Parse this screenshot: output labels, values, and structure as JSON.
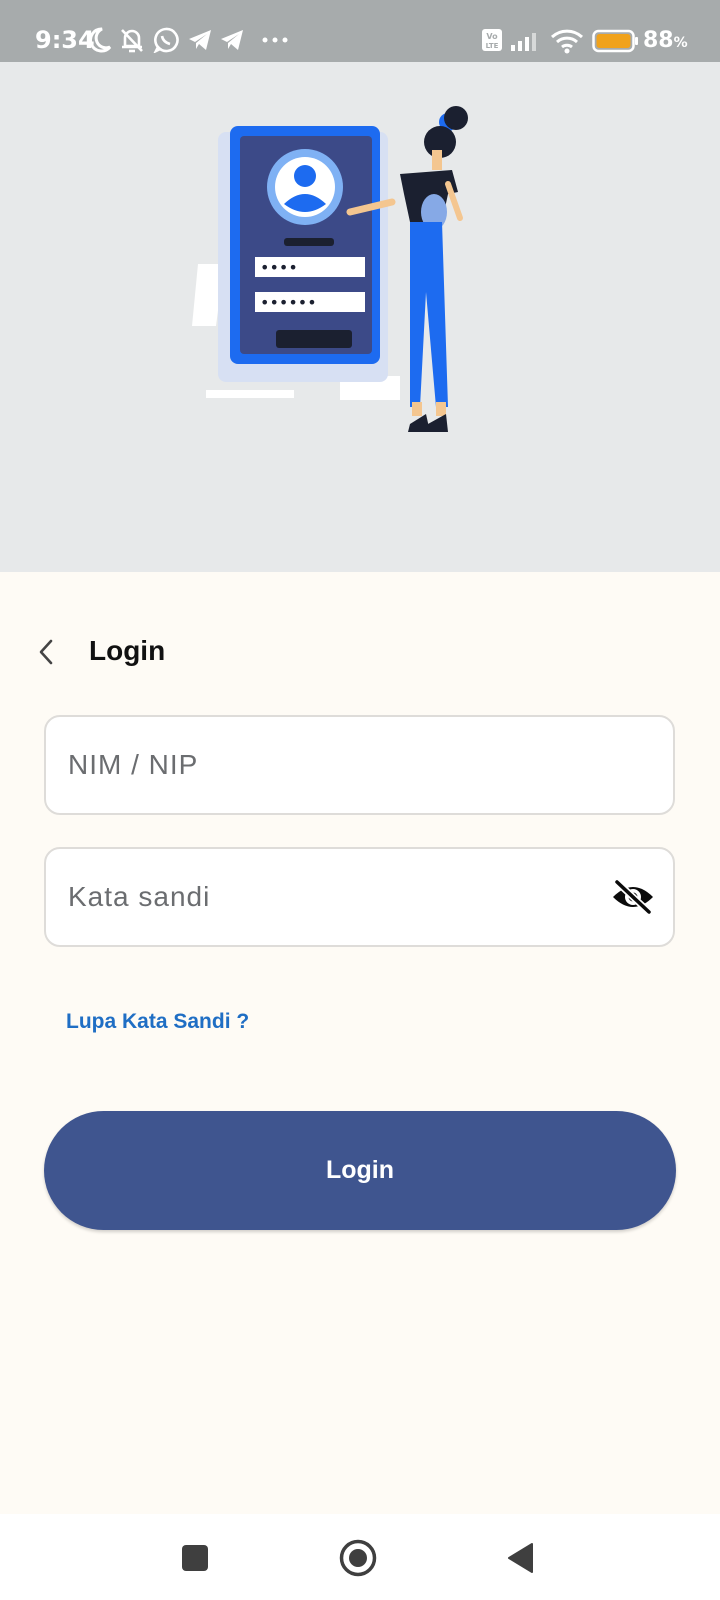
{
  "status_bar": {
    "time": "9:34",
    "battery_percent": "88",
    "battery_symbol": "%",
    "battery_level": 0.88,
    "icons": [
      "moon-icon",
      "bell-off-icon",
      "whatsapp-icon",
      "telegram-icon",
      "telegram-icon",
      "more-dots-icon",
      "volte-icon",
      "signal-icon",
      "wifi-icon",
      "battery-icon"
    ],
    "volte_label": "Vo LTE",
    "background": "#a7abac"
  },
  "hero": {
    "illustration": "person-login-screen-illustration",
    "background": "#e7e9ea",
    "password_mask_1": "••••",
    "password_mask_2": "••••••"
  },
  "header": {
    "back_icon": "chevron-left-icon",
    "title": "Login"
  },
  "form": {
    "nim": {
      "placeholder": "NIM / NIP",
      "value": ""
    },
    "password": {
      "placeholder": "Kata sandi",
      "value": "",
      "toggle_icon": "eye-off-icon"
    },
    "forgot_password": "Lupa Kata Sandi ?",
    "submit_label": "Login"
  },
  "nav_bar": {
    "recents_icon": "square-icon",
    "home_icon": "circle-home-icon",
    "back_icon": "triangle-back-icon"
  },
  "colors": {
    "primary_button": "#3f558f",
    "link": "#1f6ec4",
    "page_background": "#fefbf5",
    "field_border": "#dedcd9"
  }
}
